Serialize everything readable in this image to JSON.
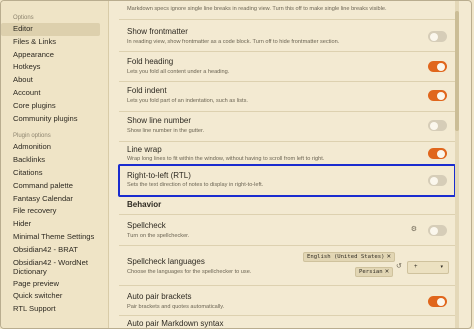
{
  "sidebar": {
    "options_heading": "Options",
    "options": [
      "Editor",
      "Files & Links",
      "Appearance",
      "Hotkeys",
      "About",
      "Account",
      "Core plugins",
      "Community plugins"
    ],
    "plugin_heading": "Plugin options",
    "plugins": [
      "Admonition",
      "Backlinks",
      "Citations",
      "Command palette",
      "Fantasy Calendar",
      "File recovery",
      "Hider",
      "Minimal Theme Settings",
      "Obsidian42 - BRAT",
      "Obsidian42 - WordNet Dictionary",
      "Page preview",
      "Quick switcher",
      "RTL Support"
    ]
  },
  "settings": {
    "markdown_note": "Markdown specs ignore single line breaks in reading view. Turn this off to make single line breaks visible.",
    "rows": [
      {
        "name": "Show frontmatter",
        "desc": "In reading view, show frontmatter as a code block. Turn off to hide frontmatter section.",
        "enabled": false
      },
      {
        "name": "Fold heading",
        "desc": "Lets you fold all content under a heading.",
        "enabled": true
      },
      {
        "name": "Fold indent",
        "desc": "Lets you fold part of an indentation, such as lists.",
        "enabled": true
      },
      {
        "name": "Show line number",
        "desc": "Show line number in the gutter.",
        "enabled": false
      },
      {
        "name": "Line wrap",
        "desc": "Wrap long lines to fit within the window, without having to scroll from left to right.",
        "enabled": true
      },
      {
        "name": "Right-to-left (RTL)",
        "desc": "Sets the text direction of notes to display in right-to-left.",
        "enabled": false
      }
    ],
    "behavior_heading": "Behavior",
    "behavior_rows": [
      {
        "name": "Spellcheck",
        "desc": "Turn on the spellchecker.",
        "enabled": false
      },
      {
        "name": "Spellcheck languages",
        "desc": "Choose the languages for the spellchecker to use."
      },
      {
        "name": "Auto pair brackets",
        "desc": "Pair brackets and quotes automatically.",
        "enabled": true
      },
      {
        "name": "Auto pair Markdown syntax",
        "desc": ""
      }
    ],
    "languages": [
      "English (United States)",
      "Persian"
    ],
    "add_language_label": "+",
    "remove_glyph": "✕",
    "dropdown_glyph": "▾"
  },
  "colors": {
    "accent": "#e0661c",
    "highlight_border": "#1a2ccf",
    "background": "#f3ead2"
  }
}
